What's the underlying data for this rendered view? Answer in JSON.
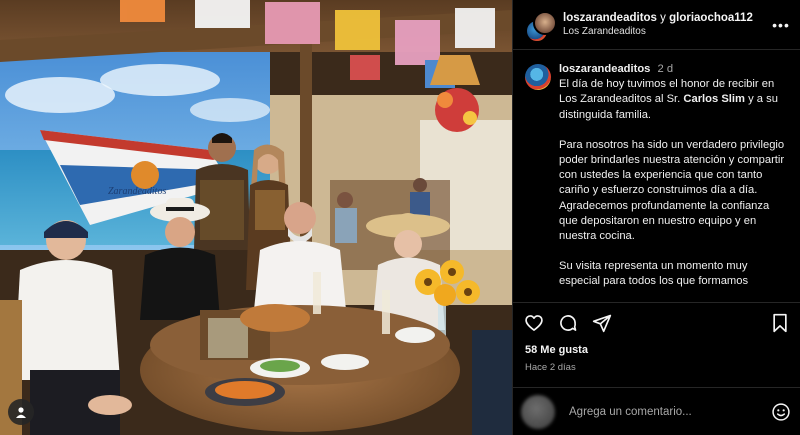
{
  "header": {
    "user1": "loszarandeaditos",
    "connector": "y",
    "user2": "gloriaochoa112",
    "subtitle": "Los Zarandeaditos"
  },
  "caption": {
    "username": "loszarandeaditos",
    "time": "2 d",
    "p1_part1": "El día de hoy tuvimos el honor de recibir en Los Zarandeaditos al Sr.",
    "p1_name": "Carlos Slim",
    "p1_part2": "y a su distinguida familia.",
    "p2": "Para nosotros ha sido un verdadero privilegio poder brindarles nuestra atención y compartir con ustedes la experiencia que con tanto cariño y esfuerzo construimos día a día. Agradecemos profundamente la confianza que depositaron en nuestro equipo y en nuestra cocina.",
    "p3": "Su visita representa un momento muy especial para todos los que formamos"
  },
  "photo": {
    "boat_name": "Zarandeaditos"
  },
  "stats": {
    "likes": "58 Me gusta",
    "ago": "Hace 2 días"
  },
  "comment": {
    "placeholder": "Agrega un comentario..."
  },
  "icons": {
    "like": "heart-icon",
    "comment": "comment-icon",
    "share": "share-icon",
    "save": "bookmark-icon",
    "more": "more-icon",
    "emoji": "emoji-icon",
    "tags": "user-tag-icon"
  },
  "colors": {
    "background": "#000000",
    "text": "#f5f5f5",
    "muted": "#a8a8a8",
    "divider": "#262626"
  }
}
